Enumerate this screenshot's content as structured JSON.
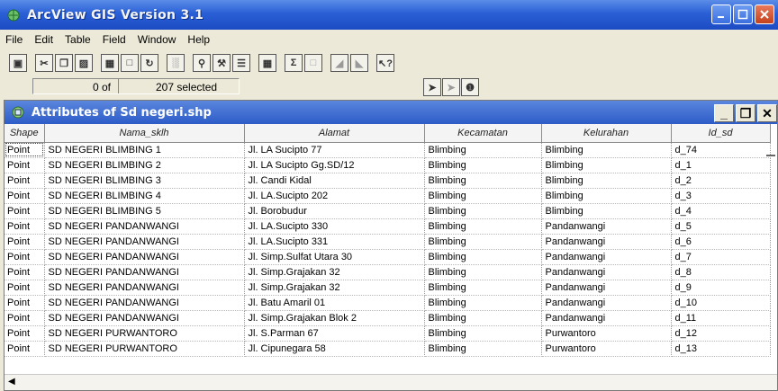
{
  "window": {
    "title": "ArcView GIS Version 3.1"
  },
  "menu": [
    "File",
    "Edit",
    "Table",
    "Field",
    "Window",
    "Help"
  ],
  "toolbar": {
    "groups": [
      [
        "save-icon"
      ],
      [
        "cut-icon",
        "copy-icon",
        "paste-icon"
      ],
      [
        "select-all-icon",
        "select-none-icon",
        "switch-selection-icon"
      ],
      [
        "chart-icon"
      ],
      [
        "find-icon",
        "query-icon",
        "promote-icon"
      ],
      [
        "calculate-icon"
      ],
      [
        "sum-icon",
        "join-icon"
      ],
      [
        "sort-ascending-icon",
        "sort-descending-icon"
      ],
      [
        "help-cursor-icon"
      ]
    ]
  },
  "status": {
    "count_text": "0 of",
    "selected_text": "207 selected"
  },
  "child_window": {
    "title": "Attributes of Sd negeri.shp"
  },
  "table": {
    "columns": [
      "Shape",
      "Nama_sklh",
      "Alamat",
      "Kecamatan",
      "Kelurahan",
      "Id_sd"
    ],
    "rows": [
      [
        "Point",
        "SD NEGERI BLIMBING 1",
        "Jl. LA Sucipto 77",
        "Blimbing",
        "Blimbing",
        "d_74"
      ],
      [
        "Point",
        "SD NEGERI BLIMBING 2",
        "Jl. LA Sucipto Gg.SD/12",
        "Blimbing",
        "Blimbing",
        "d_1"
      ],
      [
        "Point",
        "SD NEGERI BLIMBING 3",
        "Jl. Candi Kidal",
        "Blimbing",
        "Blimbing",
        "d_2"
      ],
      [
        "Point",
        "SD NEGERI BLIMBING 4",
        "Jl. LA.Sucipto 202",
        "Blimbing",
        "Blimbing",
        "d_3"
      ],
      [
        "Point",
        "SD NEGERI BLIMBING 5",
        "Jl. Borobudur",
        "Blimbing",
        "Blimbing",
        "d_4"
      ],
      [
        "Point",
        "SD NEGERI PANDANWANGI",
        "Jl. LA.Sucipto 330",
        "Blimbing",
        "Pandanwangi",
        "d_5"
      ],
      [
        "Point",
        "SD NEGERI PANDANWANGI",
        "Jl. LA.Sucipto 331",
        "Blimbing",
        "Pandanwangi",
        "d_6"
      ],
      [
        "Point",
        "SD NEGERI PANDANWANGI",
        "Jl. Simp.Sulfat Utara 30",
        "Blimbing",
        "Pandanwangi",
        "d_7"
      ],
      [
        "Point",
        "SD NEGERI PANDANWANGI",
        "Jl. Simp.Grajakan 32",
        "Blimbing",
        "Pandanwangi",
        "d_8"
      ],
      [
        "Point",
        "SD NEGERI PANDANWANGI",
        "Jl. Simp.Grajakan 32",
        "Blimbing",
        "Pandanwangi",
        "d_9"
      ],
      [
        "Point",
        "SD NEGERI PANDANWANGI",
        "Jl. Batu Amaril 01",
        "Blimbing",
        "Pandanwangi",
        "d_10"
      ],
      [
        "Point",
        "SD NEGERI PANDANWANGI",
        "Jl. Simp.Grajakan Blok 2",
        "Blimbing",
        "Pandanwangi",
        "d_11"
      ],
      [
        "Point",
        "SD NEGERI PURWANTORO",
        "Jl. S.Parman 67",
        "Blimbing",
        "Purwantoro",
        "d_12"
      ],
      [
        "Point",
        "SD NEGERI PURWANTORO",
        "Jl. Cipunegara 58",
        "Blimbing",
        "Purwantoro",
        "d_13"
      ]
    ]
  },
  "colors": {
    "title_blue": "#2a5fd6",
    "child_title_blue": "#2d5cc8",
    "close_red": "#c4421c"
  }
}
